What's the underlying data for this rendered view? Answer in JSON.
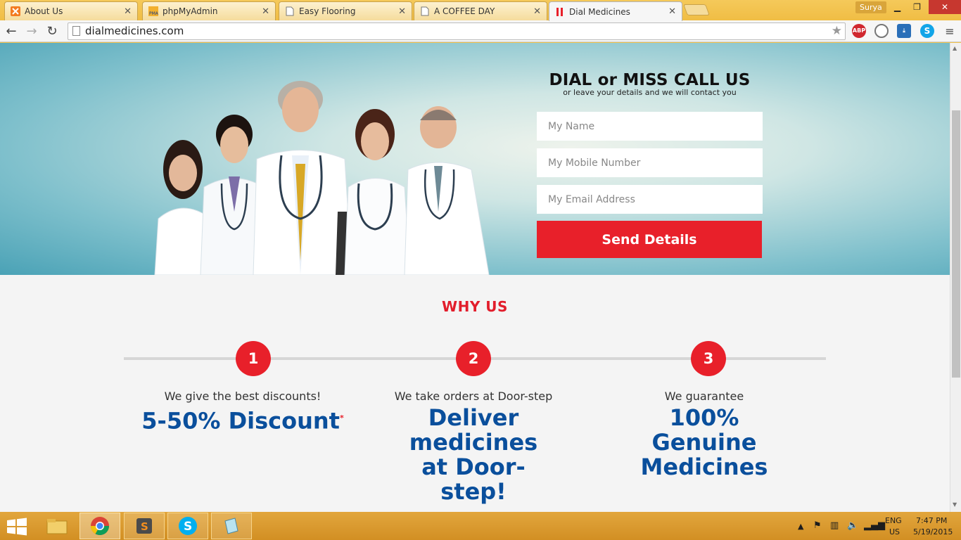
{
  "browser": {
    "tabs": [
      {
        "title": "About Us",
        "icon": "xampp-icon"
      },
      {
        "title": "phpMyAdmin",
        "icon": "pma-icon"
      },
      {
        "title": "Easy Flooring",
        "icon": "page-icon"
      },
      {
        "title": "A COFFEE DAY",
        "icon": "page-icon"
      },
      {
        "title": "Dial Medicines",
        "icon": "dial-medicines-icon",
        "active": true
      }
    ],
    "user": "Surya",
    "url": "dialmedicines.com",
    "extensions": [
      "adblock-plus-icon",
      "globe-icon",
      "download-icon",
      "skype-icon"
    ]
  },
  "hero": {
    "title": "DIAL or MISS CALL US",
    "subtitle": "or leave your details and we will contact you",
    "fields": {
      "name_placeholder": "My Name",
      "mobile_placeholder": "My Mobile Number",
      "email_placeholder": "My Email Address"
    },
    "button": "Send Details"
  },
  "why_us": {
    "title": "WHY US",
    "steps": [
      {
        "number": "1",
        "lead": "We give the best discounts!",
        "headline": "5-50% Discount",
        "footnote": "*"
      },
      {
        "number": "2",
        "lead": "We take orders at Door-step",
        "headline": "Deliver medicines at Door-step!"
      },
      {
        "number": "3",
        "lead": "We guarantee",
        "headline": "100% Genuine Medicines"
      }
    ]
  },
  "taskbar": {
    "apps": [
      "file-explorer-icon",
      "chrome-icon",
      "sublime-text-icon",
      "skype-icon",
      "notepad-icon"
    ],
    "lang": "ENG",
    "region": "US",
    "time": "7:47 PM",
    "date": "5/19/2015"
  },
  "colors": {
    "accent_red": "#e8202a",
    "heading_blue": "#0a4f9c",
    "taskbar": "#d9992d"
  }
}
